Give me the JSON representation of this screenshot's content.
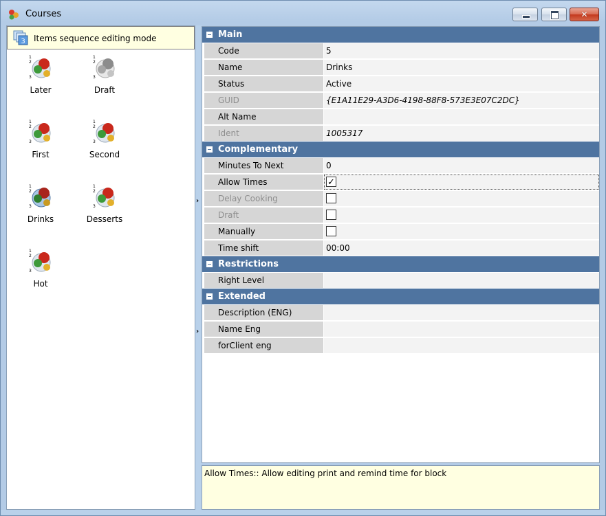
{
  "window": {
    "title": "Courses"
  },
  "sequence_mode": {
    "label": "Items sequence editing mode",
    "badge": "3"
  },
  "courses": [
    {
      "label": "Later"
    },
    {
      "label": "Draft"
    },
    {
      "label": "First"
    },
    {
      "label": "Second"
    },
    {
      "label": "Drinks"
    },
    {
      "label": "Desserts"
    },
    {
      "label": "Hot"
    }
  ],
  "properties": {
    "main": {
      "title": "Main",
      "rows": [
        {
          "name": "Code",
          "value": "5"
        },
        {
          "name": "Name",
          "value": "Drinks"
        },
        {
          "name": "Status",
          "value": "Active"
        },
        {
          "name": "GUID",
          "value": "{E1A11E29-A3D6-4198-88F8-573E3E07C2DC}"
        },
        {
          "name": "Alt Name",
          "value": ""
        },
        {
          "name": "Ident",
          "value": "1005317"
        }
      ]
    },
    "complementary": {
      "title": "Complementary",
      "rows": [
        {
          "name": "Minutes To Next",
          "value": "0"
        },
        {
          "name": "Allow Times",
          "checked": true
        },
        {
          "name": "Delay Cooking",
          "checked": false
        },
        {
          "name": "Draft",
          "checked": false
        },
        {
          "name": "Manually",
          "checked": false
        },
        {
          "name": "Time shift",
          "value": "00:00"
        }
      ]
    },
    "restrictions": {
      "title": "Restrictions",
      "rows": [
        {
          "name": "Right Level",
          "value": ""
        }
      ]
    },
    "extended": {
      "title": "Extended",
      "rows": [
        {
          "name": "Description (ENG)",
          "value": ""
        },
        {
          "name": "Name Eng",
          "value": ""
        },
        {
          "name": "forClient eng",
          "value": ""
        }
      ]
    }
  },
  "description": "Allow Times:: Allow editing print and remind time for block",
  "colors": {
    "category_header": "#4f74a0",
    "tooltip_bg": "#ffffe1",
    "frame": "#b9d1ea"
  }
}
